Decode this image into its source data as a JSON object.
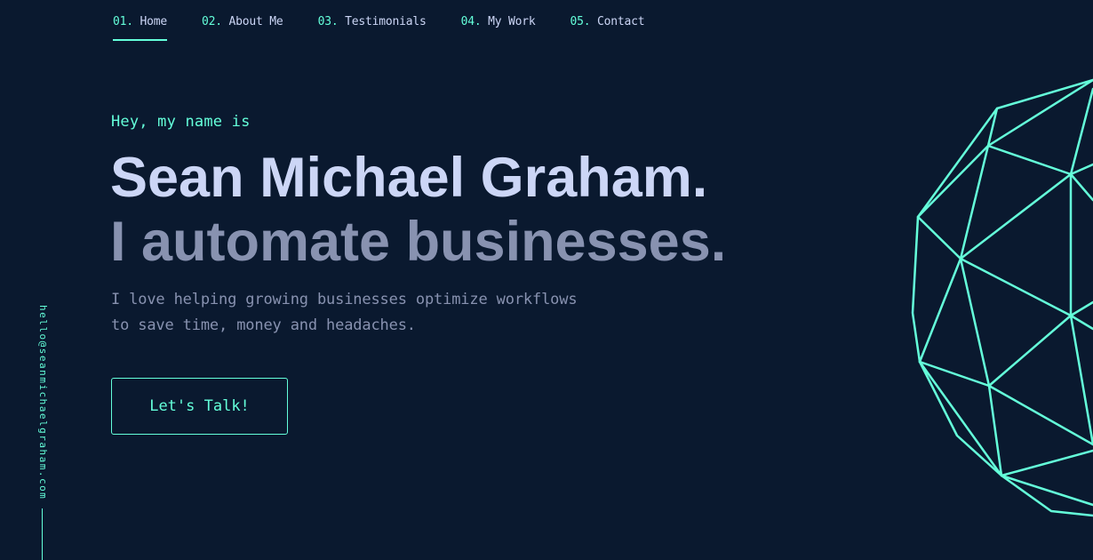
{
  "nav": {
    "items": [
      {
        "num": "01.",
        "label": "Home",
        "active": true
      },
      {
        "num": "02.",
        "label": "About Me",
        "active": false
      },
      {
        "num": "03.",
        "label": "Testimonials",
        "active": false
      },
      {
        "num": "04.",
        "label": "My Work",
        "active": false
      },
      {
        "num": "05.",
        "label": "Contact",
        "active": false
      }
    ]
  },
  "hero": {
    "greeting": "Hey, my name is",
    "name": "Sean Michael Graham.",
    "tagline": "I automate businesses.",
    "description_line1": "I love helping growing businesses optimize workflows",
    "description_line2": "to save time, money and headaches.",
    "cta_label": "Let's Talk!"
  },
  "sidebar": {
    "email": "hello@seanmichaelgraham.com"
  },
  "colors": {
    "background": "#0a192f",
    "accent": "#64ffda",
    "heading": "#ccd6f6",
    "muted": "#8892b0"
  },
  "icons": {
    "decoration": "geodesic-sphere-icon"
  }
}
